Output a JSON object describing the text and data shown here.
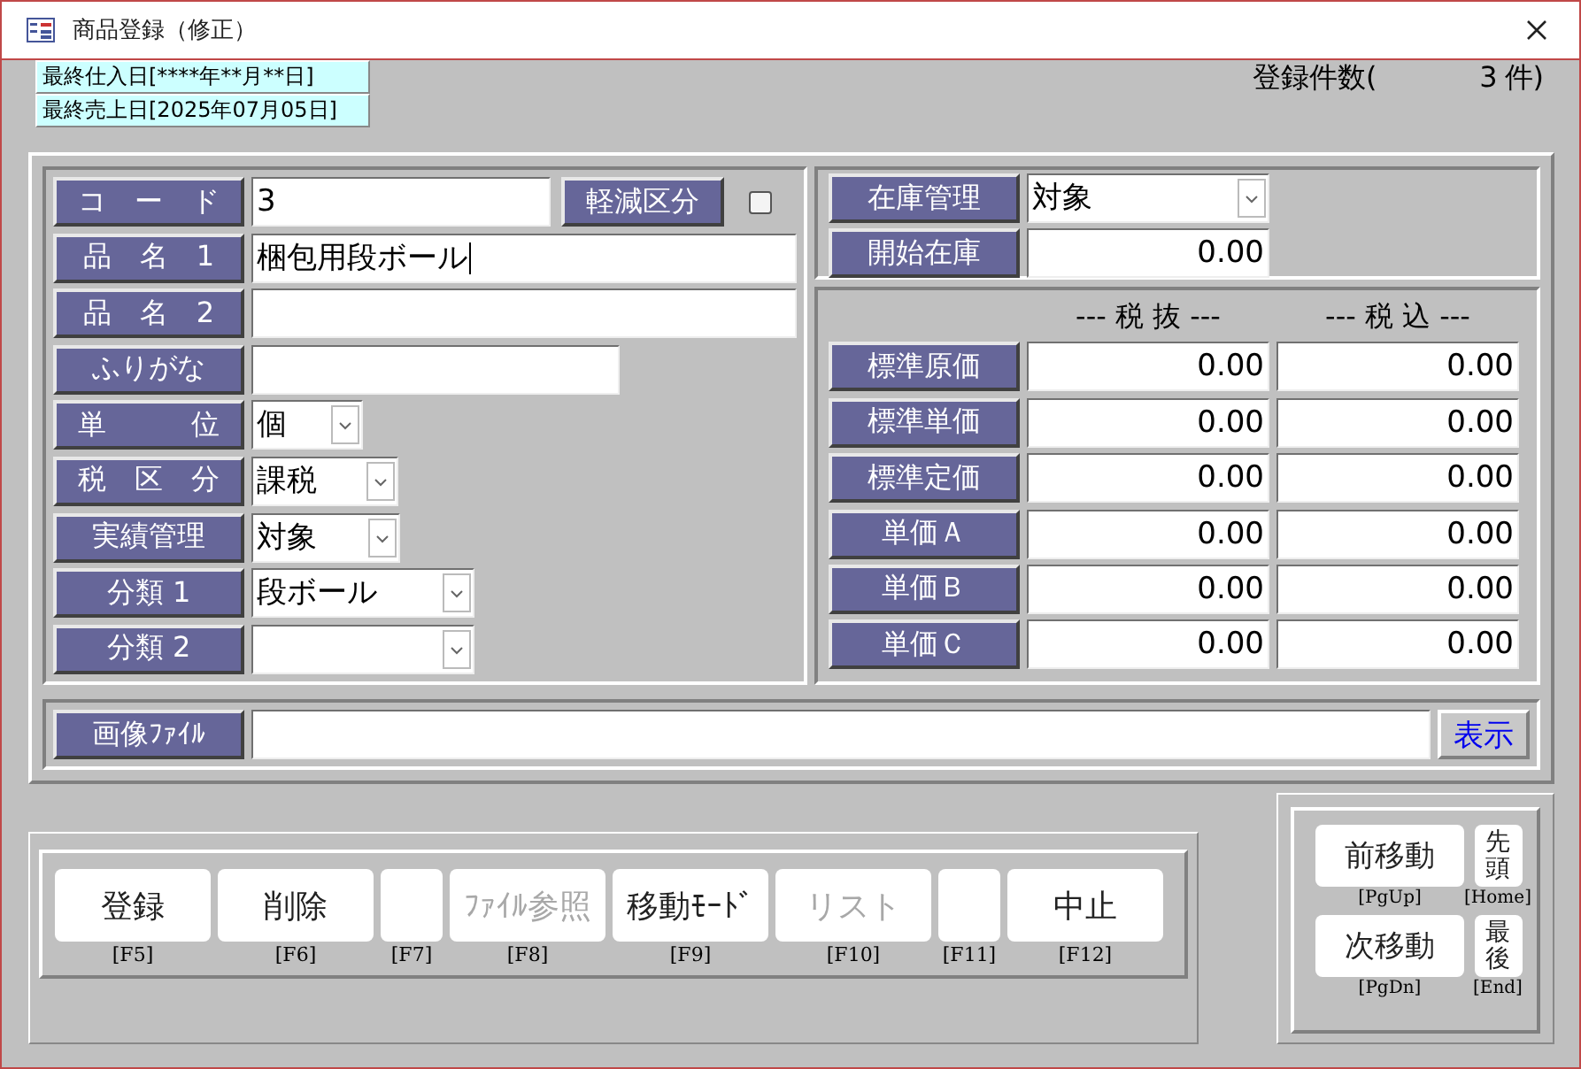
{
  "window": {
    "title": "商品登録（修正）"
  },
  "info": [
    "最終仕入日[****年**月**日]",
    "最終売上日[2025年07月05日]"
  ],
  "record_count": {
    "label": "登録件数(",
    "value": "3",
    "unit": "件)"
  },
  "left_fields": [
    {
      "label": "コ　ー　ド",
      "kind": "text",
      "value": "3"
    },
    {
      "label": "品　名　1",
      "kind": "text",
      "value": "梱包用段ボール",
      "focused": true
    },
    {
      "label": "品　名　2",
      "kind": "text"
    },
    {
      "label": "ふりがな",
      "kind": "text"
    },
    {
      "label": "単　　　位",
      "kind": "combo",
      "value": "個"
    },
    {
      "label": "税　区　分",
      "kind": "combo",
      "value": "課税"
    },
    {
      "label": "実績管理",
      "kind": "combo",
      "value": "対象"
    },
    {
      "label": "分類 1",
      "kind": "combo",
      "value": "段ボール"
    },
    {
      "label": "分類 2",
      "kind": "combo"
    }
  ],
  "reduced_tax": {
    "label": "軽減区分",
    "checked": false
  },
  "stock": [
    {
      "label": "在庫管理",
      "kind": "combo",
      "value": "対象"
    },
    {
      "label": "開始在庫",
      "kind": "number",
      "value": "0.00"
    }
  ],
  "price_headers": [
    "--- 税 抜 ---",
    "--- 税 込 ---"
  ],
  "prices": [
    {
      "label": "標準原価",
      "excl": "0.00",
      "incl": "0.00"
    },
    {
      "label": "標準単価",
      "excl": "0.00",
      "incl": "0.00"
    },
    {
      "label": "標準定価",
      "excl": "0.00",
      "incl": "0.00"
    },
    {
      "label": "単価Ａ",
      "excl": "0.00",
      "incl": "0.00"
    },
    {
      "label": "単価Ｂ",
      "excl": "0.00",
      "incl": "0.00"
    },
    {
      "label": "単価Ｃ",
      "excl": "0.00",
      "incl": "0.00"
    }
  ],
  "image_file": {
    "label": "画像ﾌｧｲﾙ",
    "button": "表示"
  },
  "function_keys": [
    {
      "label": "登録",
      "key": "[F5]",
      "disabled": false
    },
    {
      "label": "削除",
      "key": "[F6]",
      "disabled": false
    },
    {
      "key": "[F7]"
    },
    {
      "label": "ﾌｧｲﾙ参照",
      "key": "[F8]",
      "disabled": true
    },
    {
      "label": "移動ﾓｰﾄﾞ",
      "key": "[F9]",
      "disabled": false
    },
    {
      "label": "リスト",
      "key": "[F10]",
      "disabled": true
    },
    {
      "key": "[F11]"
    },
    {
      "label": "中止",
      "key": "[F12]",
      "disabled": false
    }
  ],
  "navigation": {
    "rows": [
      {
        "buttons": [
          {
            "label": "前移動",
            "key": "[PgUp]",
            "kind": "wide"
          },
          {
            "label": "先頭",
            "key": "[Home]",
            "kind": "narrow"
          }
        ]
      },
      {
        "buttons": [
          {
            "label": "次移動",
            "key": "[PgDn]",
            "kind": "wide"
          },
          {
            "label": "最後",
            "key": "[End]",
            "kind": "narrow"
          }
        ]
      }
    ]
  }
}
